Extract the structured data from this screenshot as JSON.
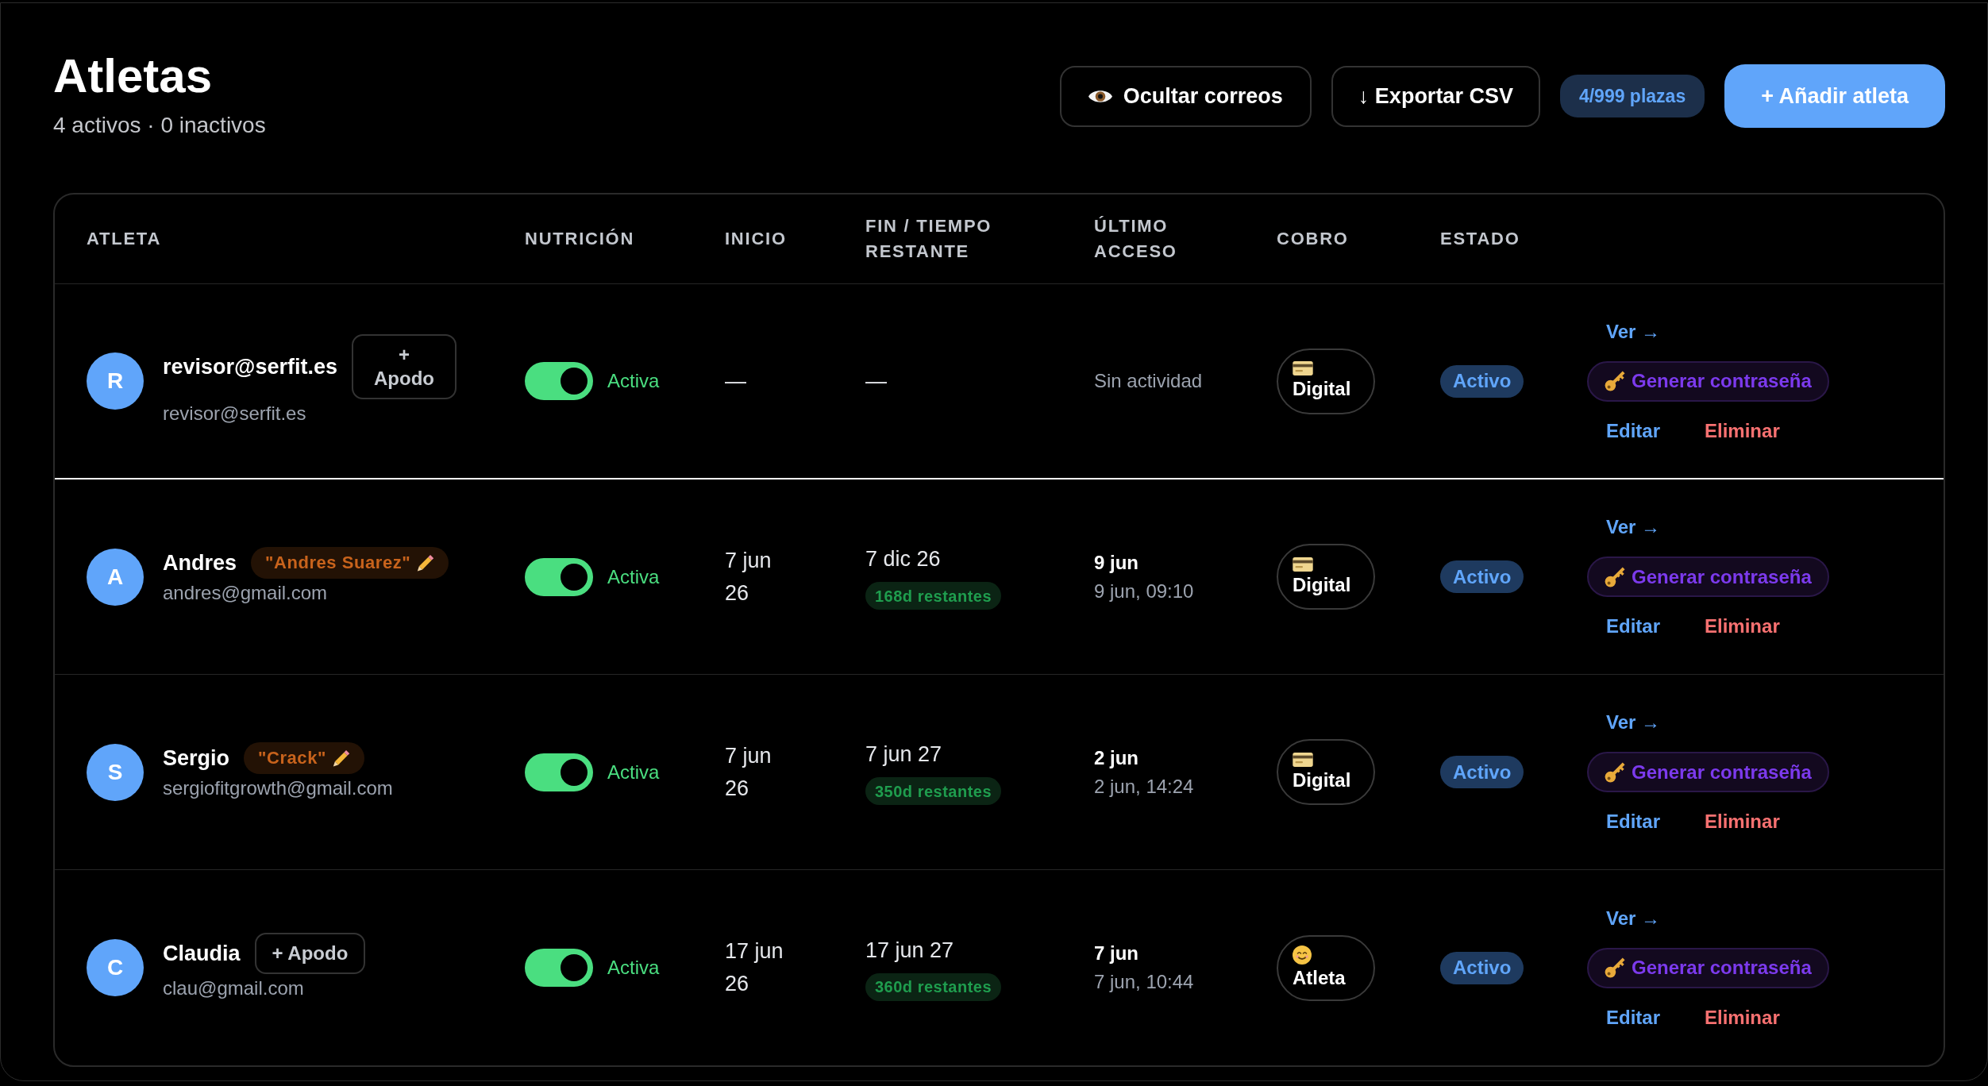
{
  "header": {
    "title": "Atletas",
    "subtitle": "4 activos · 0 inactivos"
  },
  "toolbar": {
    "hide_emails": "Ocultar correos",
    "export": "↓ Exportar CSV",
    "seats": "4/999 plazas",
    "add": "+ Añadir atleta"
  },
  "table": {
    "columns": [
      "ATLETA",
      "NUTRICIÓN",
      "INICIO",
      "FIN / TIEMPO RESTANTE",
      "ÚLTIMO ACCESO",
      "COBRO",
      "ESTADO"
    ]
  },
  "athletes": [
    {
      "initial": "R",
      "name": "revisor@serfit.es",
      "nickname": {
        "kind": "add",
        "label": "+ Apodo"
      },
      "email": "revisor@serfit.es",
      "selected": true,
      "nutrition": {
        "on": true,
        "label": "Activa"
      },
      "start": "—",
      "end": {
        "date": "—"
      },
      "last_access": {
        "detail": "Sin actividad"
      },
      "billing": {
        "kind": "digital",
        "label": "Digital"
      },
      "status": "Activo",
      "actions": {
        "view": "Ver →",
        "password": "Generar contraseña",
        "edit": "Editar",
        "delete": "Eliminar"
      }
    },
    {
      "initial": "A",
      "name": "Andres",
      "nickname": {
        "kind": "tag",
        "label": "\"Andres Suarez\""
      },
      "email": "andres@gmail.com",
      "selected": false,
      "nutrition": {
        "on": true,
        "label": "Activa"
      },
      "start": "7 jun 26",
      "end": {
        "date": "7 dic 26",
        "remaining": "168d restantes"
      },
      "last_access": {
        "day": "9 jun",
        "detail": "9 jun, 09:10"
      },
      "billing": {
        "kind": "digital",
        "label": "Digital"
      },
      "status": "Activo",
      "actions": {
        "view": "Ver →",
        "password": "Generar contraseña",
        "edit": "Editar",
        "delete": "Eliminar"
      }
    },
    {
      "initial": "S",
      "name": "Sergio",
      "nickname": {
        "kind": "tag",
        "label": "\"Crack\""
      },
      "email": "sergiofitgrowth@gmail.com",
      "selected": false,
      "nutrition": {
        "on": true,
        "label": "Activa"
      },
      "start": "7 jun 26",
      "end": {
        "date": "7 jun 27",
        "remaining": "350d restantes"
      },
      "last_access": {
        "day": "2 jun",
        "detail": "2 jun, 14:24"
      },
      "billing": {
        "kind": "digital",
        "label": "Digital"
      },
      "status": "Activo",
      "actions": {
        "view": "Ver →",
        "password": "Generar contraseña",
        "edit": "Editar",
        "delete": "Eliminar"
      }
    },
    {
      "initial": "C",
      "name": "Claudia",
      "nickname": {
        "kind": "add",
        "label": "+ Apodo"
      },
      "email": "clau@gmail.com",
      "selected": false,
      "nutrition": {
        "on": true,
        "label": "Activa"
      },
      "start": "17 jun 26",
      "end": {
        "date": "17 jun 27",
        "remaining": "360d restantes"
      },
      "last_access": {
        "day": "7 jun",
        "detail": "7 jun, 10:44"
      },
      "billing": {
        "kind": "athlete",
        "label": "Atleta"
      },
      "status": "Activo",
      "actions": {
        "view": "Ver →",
        "password": "Generar contraseña",
        "edit": "Editar",
        "delete": "Eliminar"
      }
    }
  ]
}
